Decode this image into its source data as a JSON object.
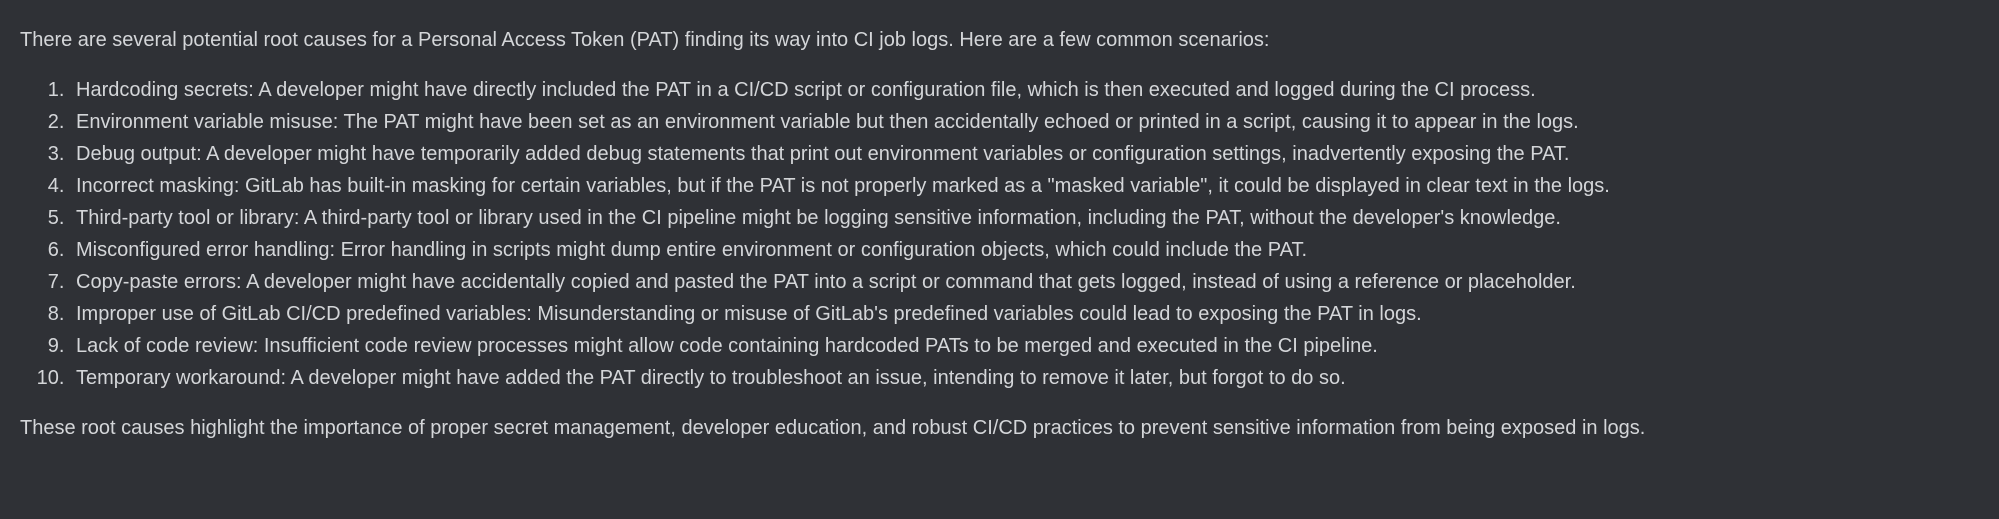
{
  "intro": "There are several potential root causes for a Personal Access Token (PAT) finding its way into CI job logs. Here are a few common scenarios:",
  "causes": [
    "Hardcoding secrets: A developer might have directly included the PAT in a CI/CD script or configuration file, which is then executed and logged during the CI process.",
    "Environment variable misuse: The PAT might have been set as an environment variable but then accidentally echoed or printed in a script, causing it to appear in the logs.",
    "Debug output: A developer might have temporarily added debug statements that print out environment variables or configuration settings, inadvertently exposing the PAT.",
    "Incorrect masking: GitLab has built-in masking for certain variables, but if the PAT is not properly marked as a \"masked variable\", it could be displayed in clear text in the logs.",
    "Third-party tool or library: A third-party tool or library used in the CI pipeline might be logging sensitive information, including the PAT, without the developer's knowledge.",
    "Misconfigured error handling: Error handling in scripts might dump entire environment or configuration objects, which could include the PAT.",
    "Copy-paste errors: A developer might have accidentally copied and pasted the PAT into a script or command that gets logged, instead of using a reference or placeholder.",
    "Improper use of GitLab CI/CD predefined variables: Misunderstanding or misuse of GitLab's predefined variables could lead to exposing the PAT in logs.",
    "Lack of code review: Insufficient code review processes might allow code containing hardcoded PATs to be merged and executed in the CI pipeline.",
    "Temporary workaround: A developer might have added the PAT directly to troubleshoot an issue, intending to remove it later, but forgot to do so."
  ],
  "closing": "These root causes highlight the importance of proper secret management, developer education, and robust CI/CD practices to prevent sensitive information from being exposed in logs."
}
